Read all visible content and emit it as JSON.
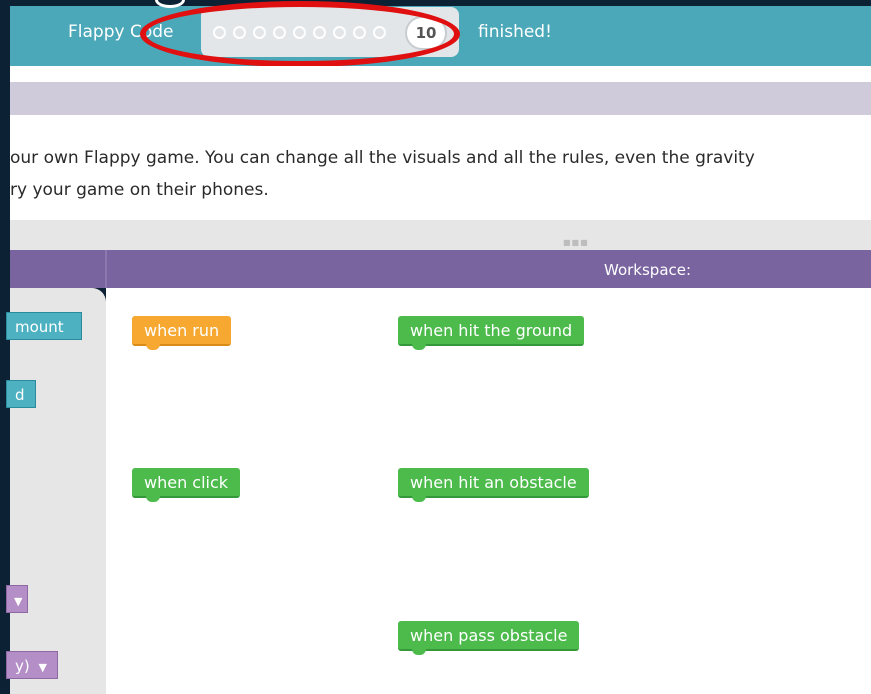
{
  "header": {
    "title_left": "Flappy Code",
    "title_right": "finished!",
    "current_level": "10",
    "progress_dot_count": 9
  },
  "instructions": {
    "line1": "our own Flappy game. You can change all the visuals and all the rules, even the gravity",
    "line2": "ry your game on their phones."
  },
  "workspace": {
    "label": "Workspace:"
  },
  "toolbox": {
    "blocks": [
      {
        "label": "mount"
      },
      {
        "label": "d"
      },
      {
        "label": ""
      },
      {
        "label": "y)"
      }
    ]
  },
  "events": [
    {
      "label": "when run"
    },
    {
      "label": "when click"
    },
    {
      "label": "when hit the ground"
    },
    {
      "label": "when hit an obstacle"
    },
    {
      "label": "when pass obstacle"
    }
  ],
  "colors": {
    "header_teal": "#4aa8b8",
    "header_purple": "#7964a0",
    "event_orange": "#f6a830",
    "event_green": "#4cbb4c",
    "annotation_red": "#e01010"
  }
}
